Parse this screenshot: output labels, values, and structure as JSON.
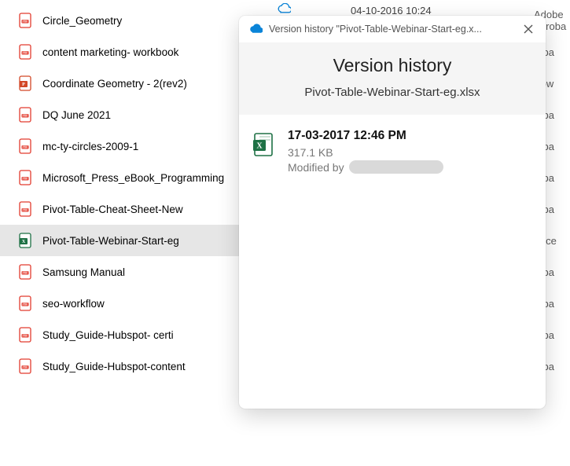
{
  "files": [
    {
      "name": "Circle_Geometry",
      "icon": "pdf",
      "assoc": "Adobe Acroba"
    },
    {
      "name": "content marketing- workbook",
      "icon": "pdf",
      "assoc": "roba"
    },
    {
      "name": "Coordinate Geometry - 2(rev2)",
      "icon": "pptx",
      "assoc": "Pow"
    },
    {
      "name": "DQ June 2021",
      "icon": "pdf",
      "assoc": "roba"
    },
    {
      "name": "mc-ty-circles-2009-1",
      "icon": "pdf",
      "assoc": "roba"
    },
    {
      "name": "Microsoft_Press_eBook_Programming",
      "icon": "pdf",
      "assoc": "roba"
    },
    {
      "name": "Pivot-Table-Cheat-Sheet-New",
      "icon": "pdf",
      "assoc": "roba"
    },
    {
      "name": "Pivot-Table-Webinar-Start-eg",
      "icon": "xlsx",
      "assoc": "Exce",
      "selected": true
    },
    {
      "name": "Samsung Manual",
      "icon": "pdf",
      "assoc": "roba"
    },
    {
      "name": "seo-workflow",
      "icon": "pdf",
      "assoc": "roba"
    },
    {
      "name": "Study_Guide-Hubspot- certi",
      "icon": "pdf",
      "assoc": "roba"
    },
    {
      "name": "Study_Guide-Hubspot-content",
      "icon": "pdf",
      "assoc": "roba"
    }
  ],
  "top_row_date": "04-10-2016 10:24",
  "panel": {
    "titlebar": "Version history \"Pivot-Table-Webinar-Start-eg.x...",
    "heading": "Version history",
    "filename": "Pivot-Table-Webinar-Start-eg.xlsx",
    "entry": {
      "when": "17-03-2017 12:46 PM",
      "size": "317.1 KB",
      "modified_label": "Modified by"
    }
  }
}
